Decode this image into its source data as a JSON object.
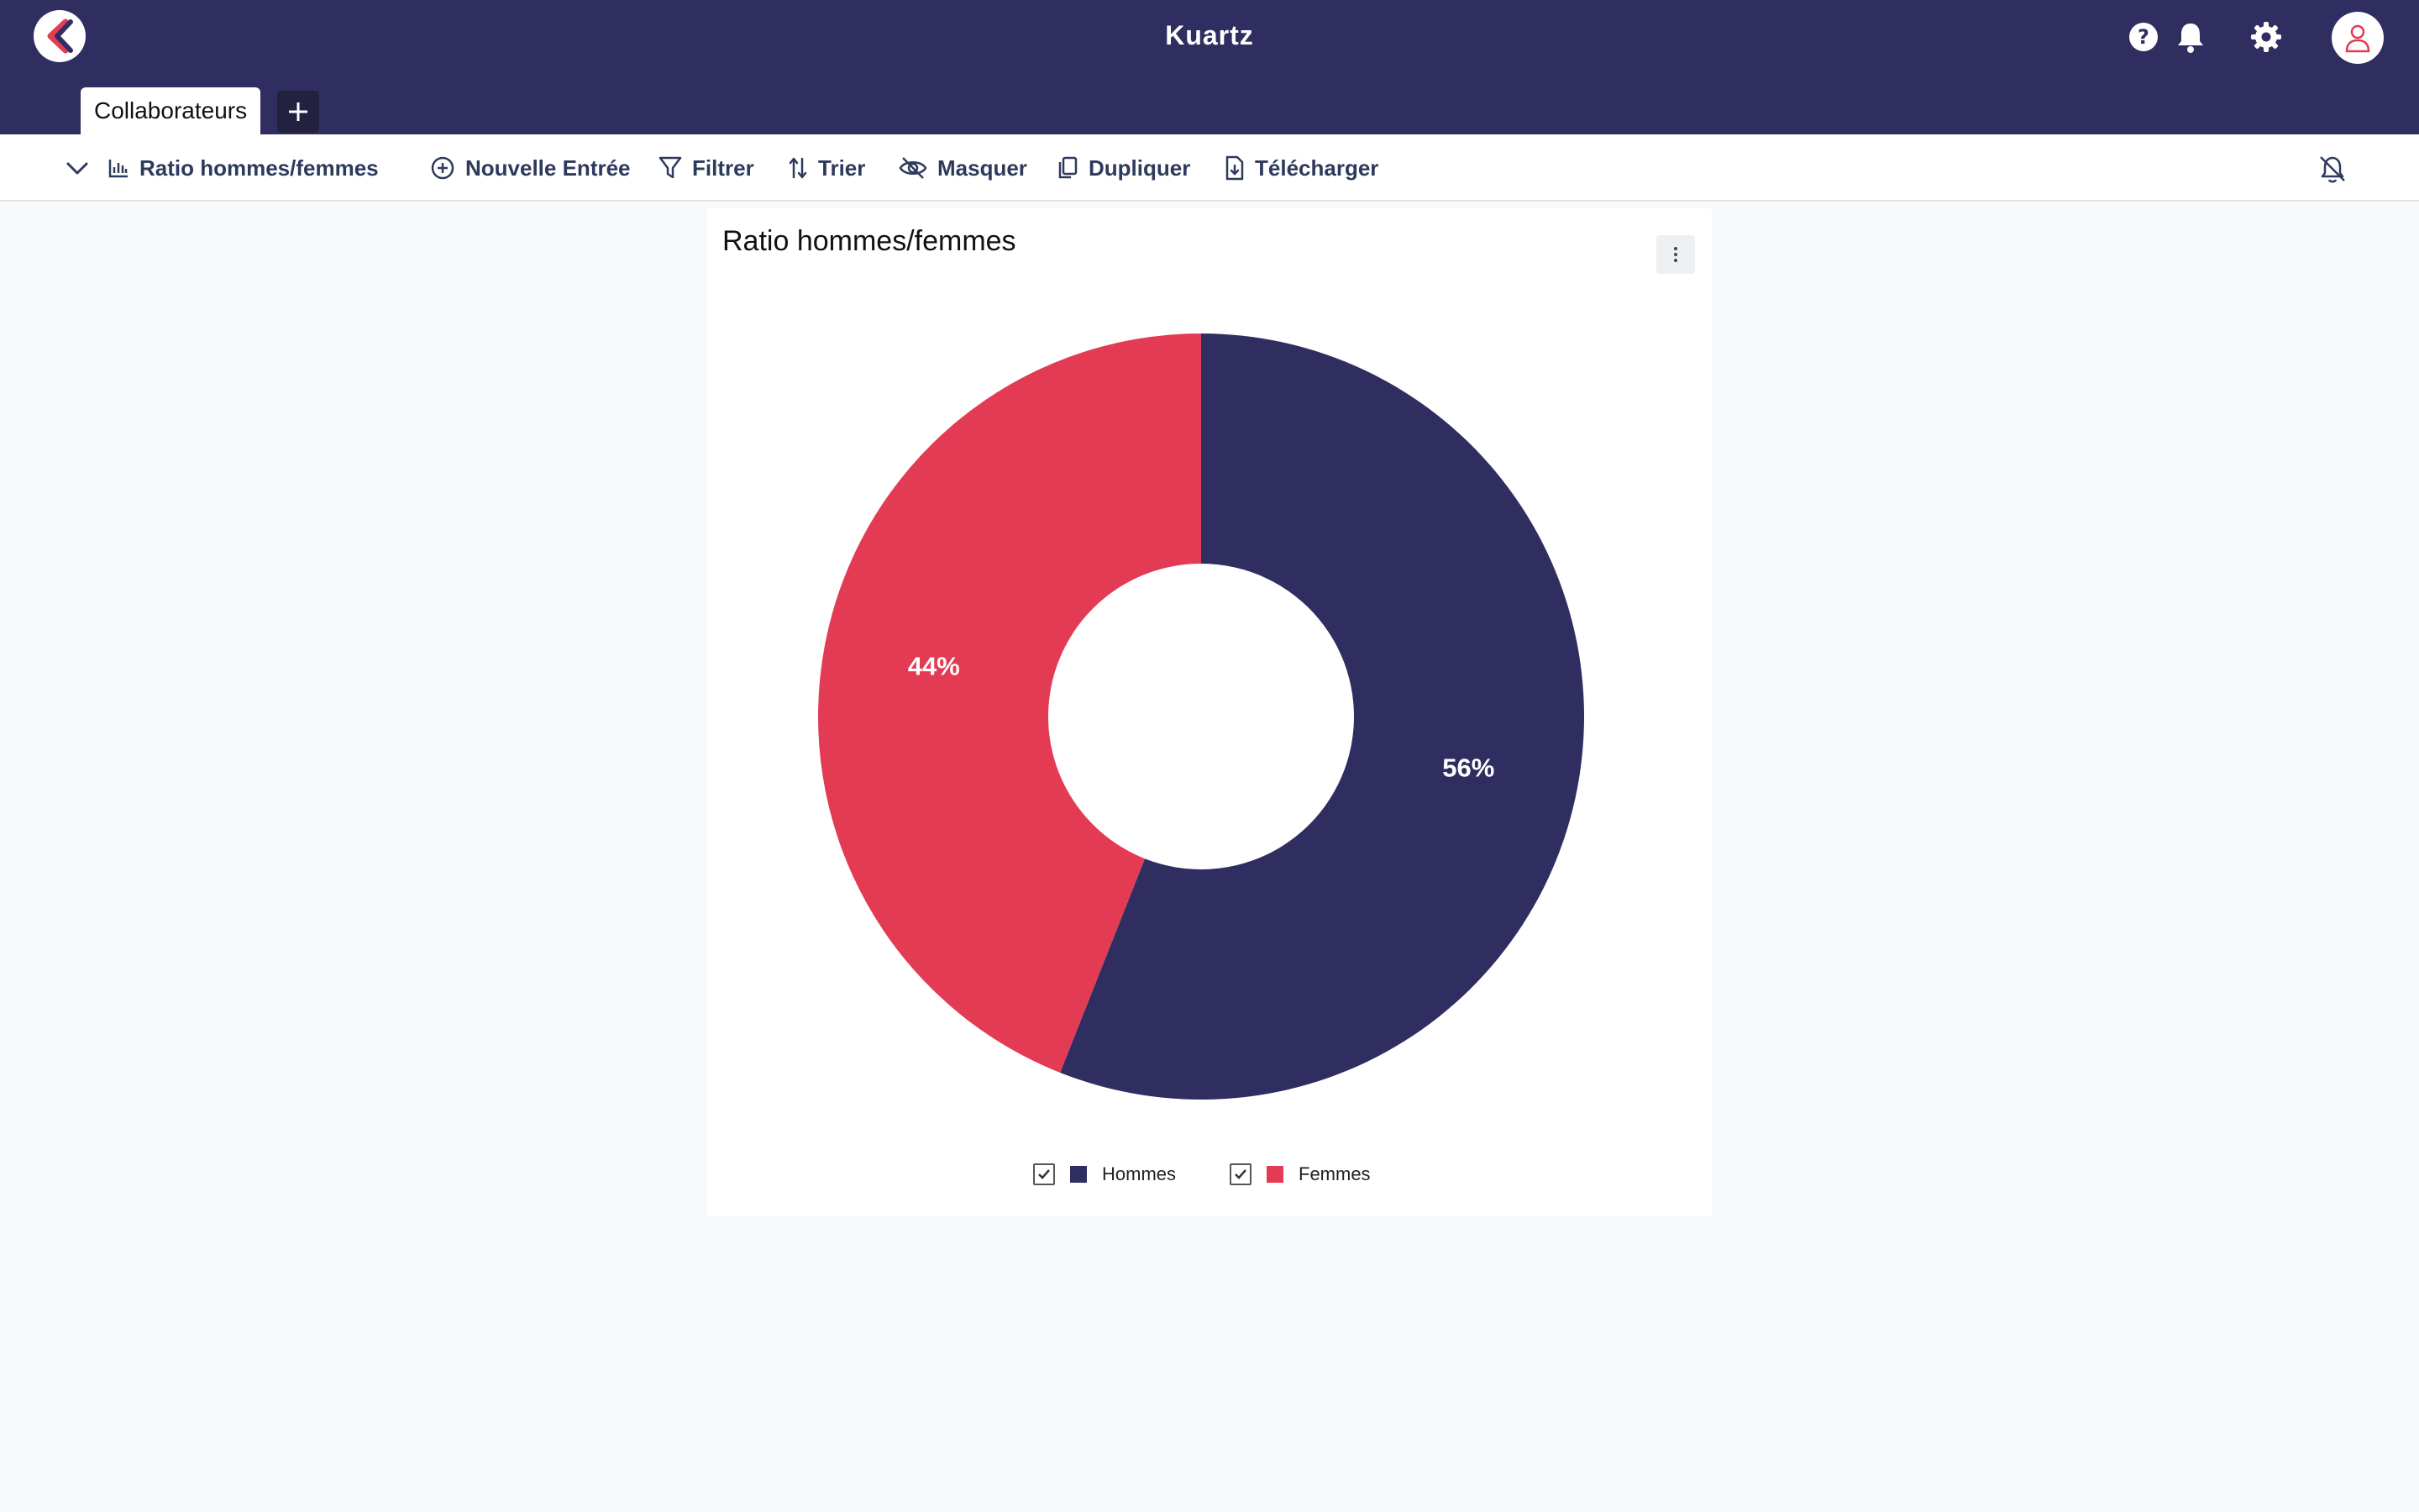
{
  "header": {
    "app_title": "Kuartz",
    "colors": {
      "background": "#302e61",
      "accent": "#e33b54"
    },
    "icons": [
      "logo-icon",
      "help-icon",
      "bell-icon",
      "gear-icon",
      "avatar-icon"
    ]
  },
  "tabs": [
    {
      "label": "Collaborateurs",
      "active": true
    }
  ],
  "toolbar": {
    "view_label": "Ratio hommes/femmes",
    "new_entry_label": "Nouvelle Entrée",
    "filter_label": "Filtrer",
    "sort_label": "Trier",
    "hide_label": "Masquer",
    "duplicate_label": "Dupliquer",
    "download_label": "Télécharger"
  },
  "card": {
    "title": "Ratio hommes/femmes"
  },
  "chart_data": {
    "type": "pie",
    "style": "donut",
    "title": "Ratio hommes/femmes",
    "categories": [
      "Hommes",
      "Femmes"
    ],
    "values": [
      56,
      44
    ],
    "labels": [
      "56%",
      "44%"
    ],
    "colors": [
      "#302e61",
      "#e33b54"
    ],
    "legend": "bottom"
  }
}
